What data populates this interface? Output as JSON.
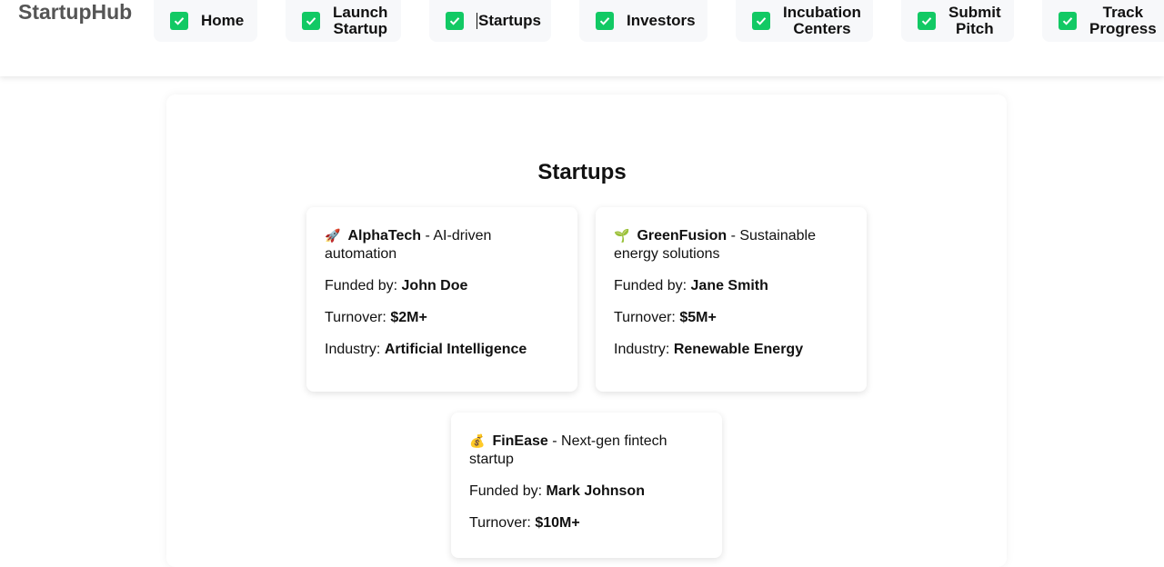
{
  "brand": "StartupHub",
  "nav": [
    {
      "line1": "Home",
      "line2": ""
    },
    {
      "line1": "Launch",
      "line2": "Startup"
    },
    {
      "line1": "Startups",
      "line2": ""
    },
    {
      "line1": "Investors",
      "line2": ""
    },
    {
      "line1": "Incubation",
      "line2": "Centers"
    },
    {
      "line1": "Submit",
      "line2": "Pitch"
    },
    {
      "line1": "Track",
      "line2": "Progress"
    }
  ],
  "colors": {
    "check": "#12c964",
    "brand": "#555555"
  },
  "main": {
    "title": "Startups"
  },
  "labels": {
    "funded_by": "Funded by:",
    "turnover": "Turnover:",
    "industry": "Industry:"
  },
  "startups": [
    {
      "icon": "🚀",
      "icon_name": "rocket-icon",
      "name": "AlphaTech",
      "desc": " - AI-driven automation",
      "funded_by": "John Doe",
      "turnover": "$2M+",
      "industry": "Artificial Intelligence"
    },
    {
      "icon": "🌱",
      "icon_name": "seedling-icon",
      "name": "GreenFusion",
      "desc": " - Sustainable energy solutions",
      "funded_by": "Jane Smith",
      "turnover": "$5M+",
      "industry": "Renewable Energy"
    },
    {
      "icon": "💰",
      "icon_name": "money-bag-icon",
      "name": "FinEase",
      "desc": " - Next-gen fintech startup",
      "funded_by": "Mark Johnson",
      "turnover": "$10M+",
      "industry": ""
    }
  ]
}
